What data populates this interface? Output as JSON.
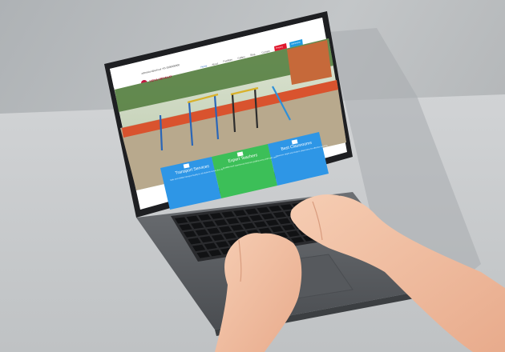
{
  "site": {
    "contact_bar": "admission@school   +91 0000000000",
    "brand": "VIDYA VIDYALAY",
    "nav_items": [
      "Home",
      "About",
      "Facilities",
      "Gallery",
      "Blog",
      "Contact"
    ],
    "cta_red": "Enquiry",
    "cta_blue": "Admission",
    "features": [
      {
        "title": "Transport Services",
        "desc": "Safe and reliable transport facility for all students across the city.",
        "color": "#2e96e6",
        "icon": "bus-icon"
      },
      {
        "title": "Expert Teachers",
        "desc": "Qualified and experienced teachers guiding every child with care.",
        "color": "#3cbf58",
        "icon": "teacher-icon"
      },
      {
        "title": "Best Classrooms",
        "desc": "Spacious, bright and modern classrooms for effective learning.",
        "color": "#2e96e6",
        "icon": "classroom-icon"
      }
    ]
  },
  "colors": {
    "wall": "#b9bcbf",
    "desk": "#c9cccf",
    "laptop_body": "#5d6064",
    "keyboard": "#1c1d1f",
    "skin": "#f3c1a4"
  }
}
